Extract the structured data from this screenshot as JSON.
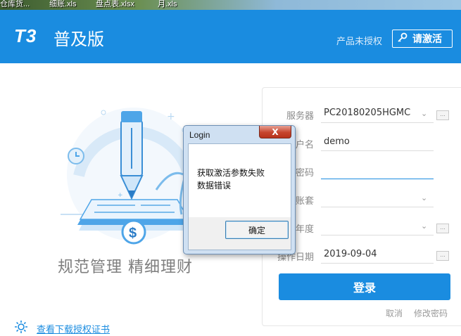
{
  "desktop": {
    "files": [
      "仓库货...",
      "细账.xls",
      "盘点表.xlsx",
      "月.xls"
    ]
  },
  "header": {
    "logo": "T3",
    "product": "普及版",
    "unauthorized": "产品未授权",
    "activate_label": "请激活"
  },
  "left": {
    "slogan": "规范管理  精细理财",
    "download_link": "查看下载授权证书"
  },
  "login": {
    "server_label": "服务器",
    "server_value": "PC20180205HGMC",
    "user_label": "户名",
    "user_value": "demo",
    "password_label": "密码",
    "password_value": "",
    "account_label": "账套",
    "account_value": "",
    "year_label": "年度",
    "year_value": "",
    "date_label": "操作日期",
    "date_value": "2019-09-04",
    "mini_button": "...",
    "login_button": "登录",
    "cancel_link": "取消",
    "change_password_link": "修改密码"
  },
  "dialog": {
    "title": "Login",
    "close": "X",
    "message_line1": "获取激活参数失败",
    "message_line2": "数据错误",
    "ok_button": "确定"
  },
  "colors": {
    "accent": "#1a8ce0",
    "dialog_frame": "#cfe0f2",
    "close_button": "#c6452e"
  },
  "icons": {
    "activate": "key-icon",
    "download": "gear-icon",
    "dropdown": "chevron-down-icon"
  }
}
